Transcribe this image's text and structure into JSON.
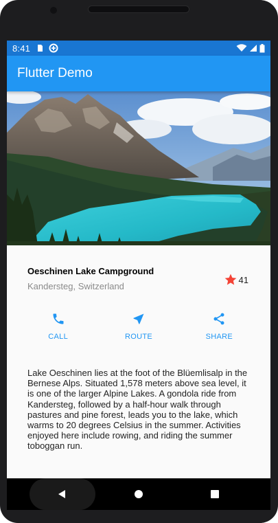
{
  "status_bar": {
    "time": "8:41",
    "left_icons": [
      "sd-card-icon",
      "data-saver-icon"
    ],
    "right_icons": [
      "wifi-icon",
      "signal-icon",
      "battery-icon"
    ]
  },
  "app_bar": {
    "title": "Flutter Demo"
  },
  "place": {
    "name": "Oeschinen Lake Campground",
    "location": "Kandersteg, Switzerland",
    "rating_count": "41"
  },
  "actions": [
    {
      "label": "CALL",
      "icon": "phone-icon"
    },
    {
      "label": "ROUTE",
      "icon": "navigation-icon"
    },
    {
      "label": "SHARE",
      "icon": "share-icon"
    }
  ],
  "description": "Lake Oeschinen lies at the foot of the Blüemlisalp in the Bernese Alps. Situated 1,578 meters above sea level, it is one of the larger Alpine Lakes. A gondola ride from Kandersteg, followed by a half-hour walk through pastures and pine forest, leads you to the lake, which warms to 20 degrees Celsius in the summer. Activities enjoyed here include rowing, and riding the summer toboggan run.",
  "colors": {
    "primary": "#2196f3",
    "primary_dark": "#1976d2",
    "star": "#f44336"
  },
  "nav_bar": {
    "buttons": [
      "back-icon",
      "home-icon",
      "recents-icon"
    ]
  }
}
